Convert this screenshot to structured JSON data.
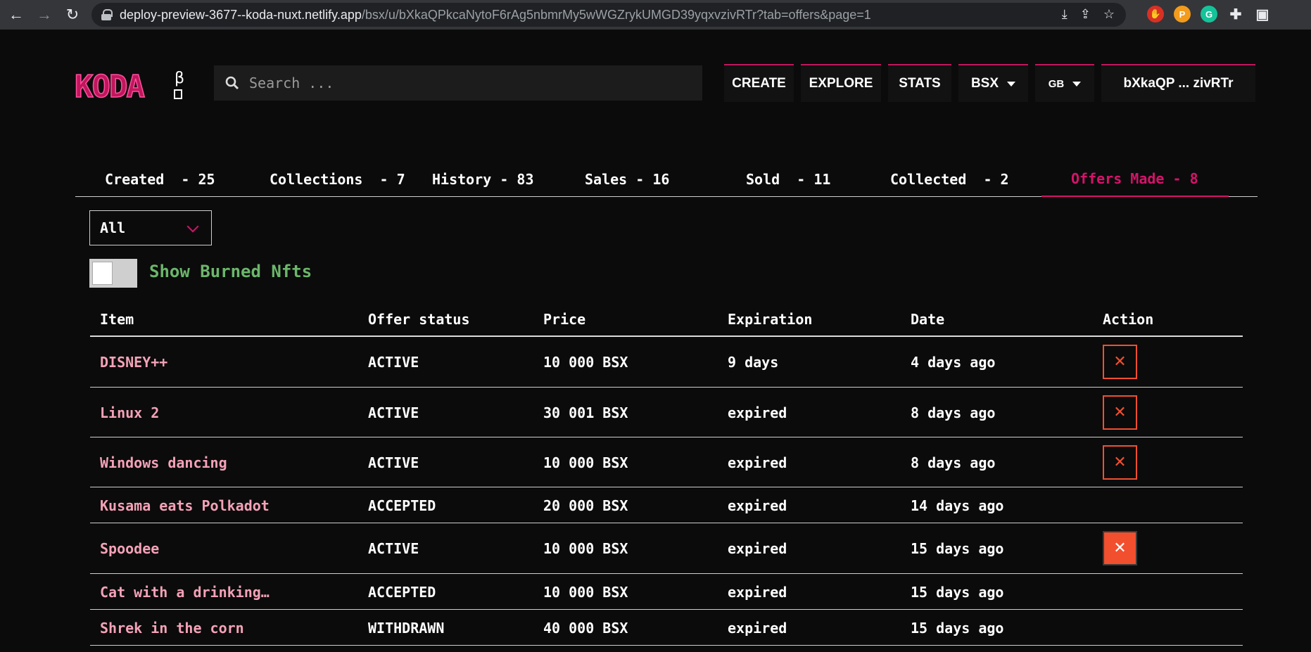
{
  "browser": {
    "url_host": "deploy-preview-3677--koda-nuxt.netlify.app",
    "url_path": "/bsx/u/bXkaQPkcaNytoF6rAg5nbmrMy5wWGZrykUMGD39yqxvzivRTr?tab=offers&page=1"
  },
  "header": {
    "logo_text": "KODA",
    "logo_badge": "β",
    "search_placeholder": "Search ...",
    "nav": {
      "create": "CREATE",
      "explore": "EXPLORE",
      "stats": "STATS",
      "chain": "BSX",
      "language": "GB",
      "account": "bXkaQP ... zivRTr"
    }
  },
  "tabs": [
    {
      "label": "Created  - 25"
    },
    {
      "label": "Collections  - 7"
    },
    {
      "label": "History - 83"
    },
    {
      "label": "Sales - 16"
    },
    {
      "label": "Sold  - 11"
    },
    {
      "label": "Collected  - 2"
    },
    {
      "label": "Offers Made - 8",
      "active": true
    }
  ],
  "filter": {
    "selected": "All",
    "toggle_label": "Show Burned Nfts"
  },
  "table": {
    "headers": {
      "item": "Item",
      "status": "Offer status",
      "price": "Price",
      "expiration": "Expiration",
      "date": "Date",
      "action": "Action"
    },
    "rows": [
      {
        "item": "DISNEY++",
        "status": "ACTIVE",
        "price": "10 000 BSX",
        "expiration": "9 days",
        "date": "4 days ago",
        "action": "✕"
      },
      {
        "item": "Linux 2",
        "status": "ACTIVE",
        "price": "30 001 BSX",
        "expiration": "expired",
        "date": "8 days ago",
        "action": "✕"
      },
      {
        "item": "Windows dancing",
        "status": "ACTIVE",
        "price": "10 000 BSX",
        "expiration": "expired",
        "date": "8 days ago",
        "action": "✕"
      },
      {
        "item": "Kusama eats Polkadot",
        "status": "ACCEPTED",
        "price": "20 000 BSX",
        "expiration": "expired",
        "date": "14 days ago",
        "action": ""
      },
      {
        "item": "Spoodee",
        "status": "ACTIVE",
        "price": "10 000 BSX",
        "expiration": "expired",
        "date": "15 days ago",
        "action": "✕"
      },
      {
        "item": "Cat with a drinking…",
        "status": "ACCEPTED",
        "price": "10 000 BSX",
        "expiration": "expired",
        "date": "15 days ago",
        "action": ""
      },
      {
        "item": "Shrek in the corn",
        "status": "WITHDRAWN",
        "price": "40 000 BSX",
        "expiration": "expired",
        "date": "15 days ago",
        "action": ""
      }
    ]
  },
  "colors": {
    "accent": "#d5136a",
    "item_link": "#f4a2b8",
    "toggle_label": "#6bb66b",
    "cancel": "#f24f2f"
  }
}
